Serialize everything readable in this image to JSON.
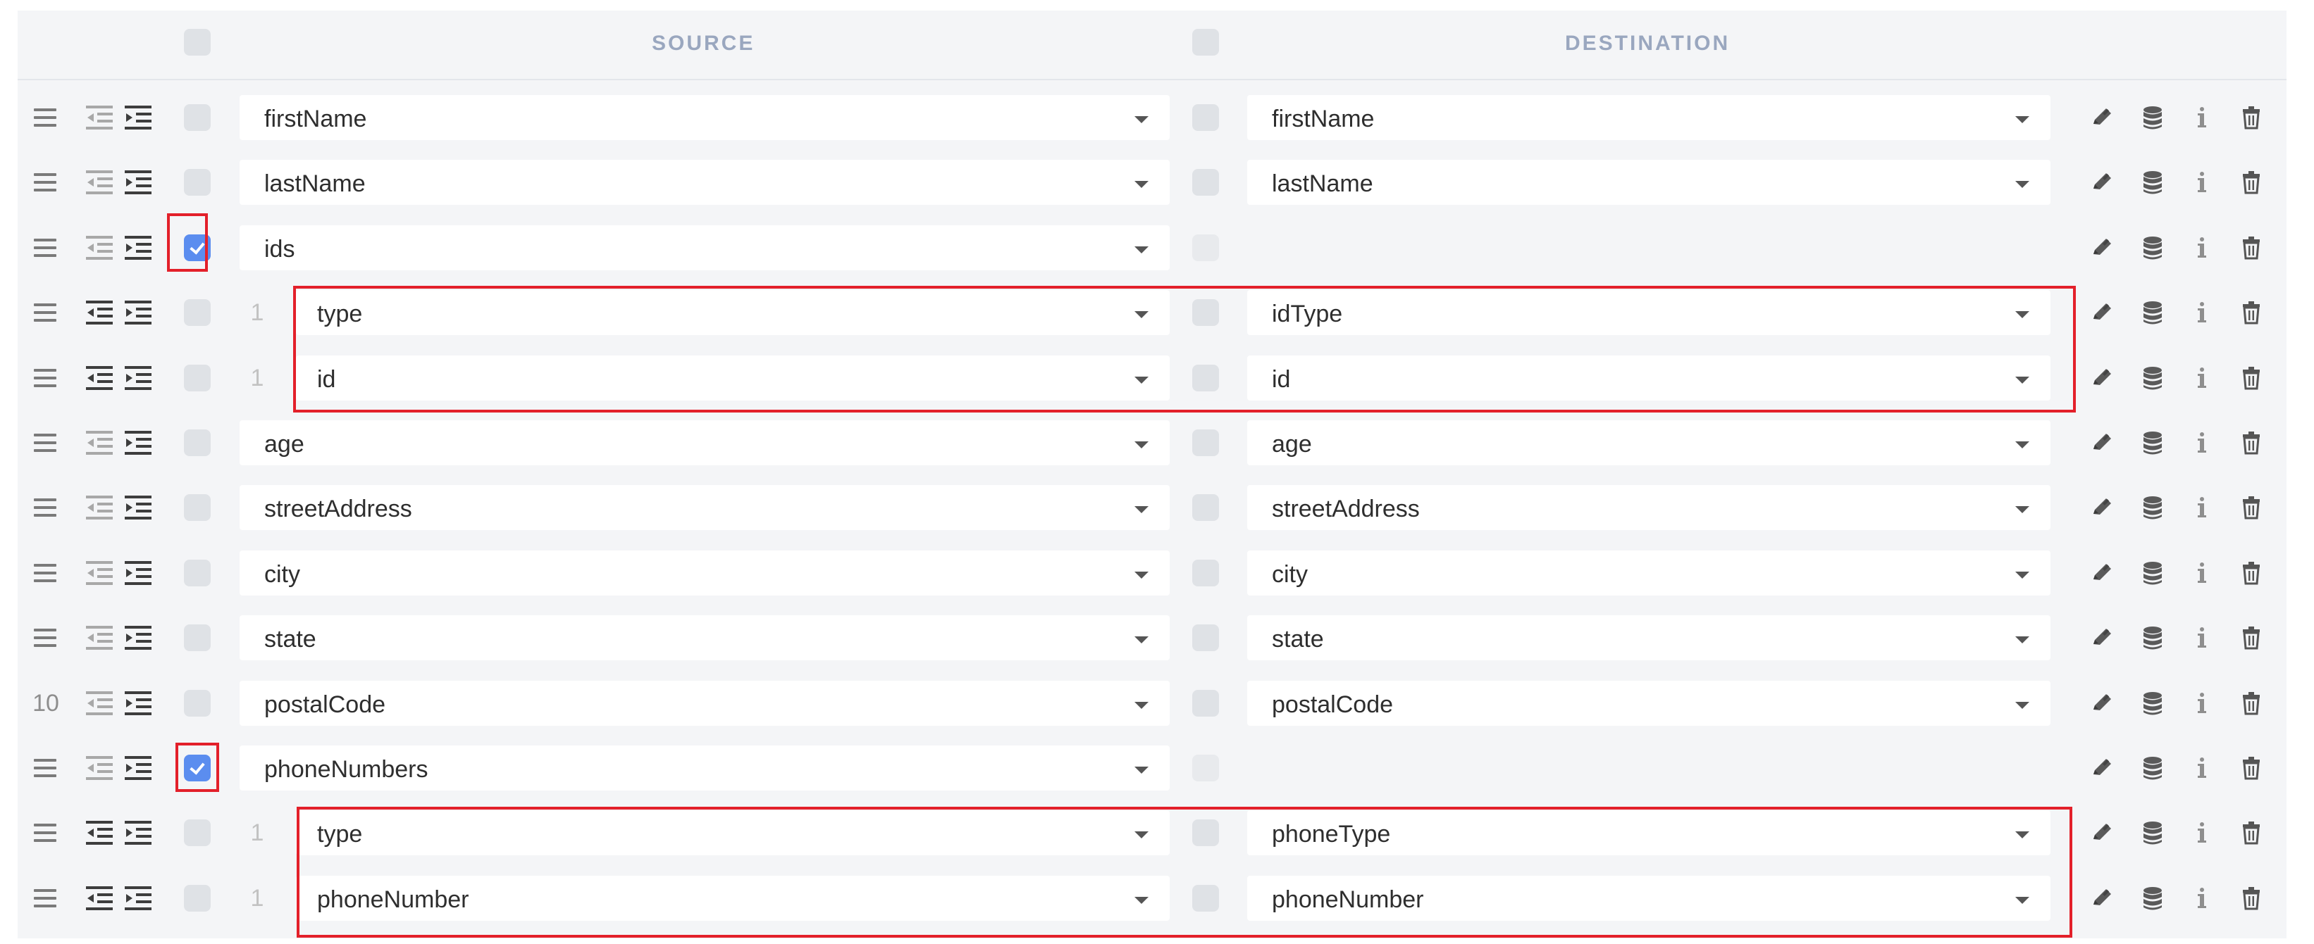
{
  "header": {
    "source_title": "SOURCE",
    "destination_title": "DESTINATION"
  },
  "colors": {
    "panel": "#f4f5f7",
    "checked": "#5b8def",
    "highlight_box": "#e3202a",
    "header_text": "#9aa7bf"
  },
  "icons": {
    "drag": "drag-handle-icon",
    "outdent": "outdent-icon",
    "indent": "indent-icon",
    "edit": "pencil-icon",
    "database": "database-icon",
    "info": "info-icon",
    "delete": "trash-icon"
  },
  "rows": [
    {
      "handle": "",
      "number": "",
      "child_marker": "",
      "source": "firstName",
      "destination": "firstName",
      "source_checked": false,
      "has_destination": true
    },
    {
      "handle": "",
      "number": "",
      "child_marker": "",
      "source": "lastName",
      "destination": "lastName",
      "source_checked": false,
      "has_destination": true
    },
    {
      "handle": "",
      "number": "",
      "child_marker": "",
      "source": "ids",
      "destination": "",
      "source_checked": true,
      "has_destination": false
    },
    {
      "handle": "",
      "number": "",
      "child_marker": "1",
      "source": "type",
      "destination": "idType",
      "source_checked": false,
      "has_destination": true
    },
    {
      "handle": "",
      "number": "",
      "child_marker": "1",
      "source": "id",
      "destination": "id",
      "source_checked": false,
      "has_destination": true
    },
    {
      "handle": "",
      "number": "",
      "child_marker": "",
      "source": "age",
      "destination": "age",
      "source_checked": false,
      "has_destination": true
    },
    {
      "handle": "",
      "number": "",
      "child_marker": "",
      "source": "streetAddress",
      "destination": "streetAddress",
      "source_checked": false,
      "has_destination": true
    },
    {
      "handle": "",
      "number": "",
      "child_marker": "",
      "source": "city",
      "destination": "city",
      "source_checked": false,
      "has_destination": true
    },
    {
      "handle": "",
      "number": "",
      "child_marker": "",
      "source": "state",
      "destination": "state",
      "source_checked": false,
      "has_destination": true
    },
    {
      "handle": "",
      "number": "10",
      "child_marker": "",
      "source": "postalCode",
      "destination": "postalCode",
      "source_checked": false,
      "has_destination": true
    },
    {
      "handle": "",
      "number": "",
      "child_marker": "",
      "source": "phoneNumbers",
      "destination": "",
      "source_checked": true,
      "has_destination": false
    },
    {
      "handle": "",
      "number": "",
      "child_marker": "1",
      "source": "type",
      "destination": "phoneType",
      "source_checked": false,
      "has_destination": true
    },
    {
      "handle": "",
      "number": "",
      "child_marker": "1",
      "source": "phoneNumber",
      "destination": "phoneNumber",
      "source_checked": false,
      "has_destination": true
    }
  ]
}
